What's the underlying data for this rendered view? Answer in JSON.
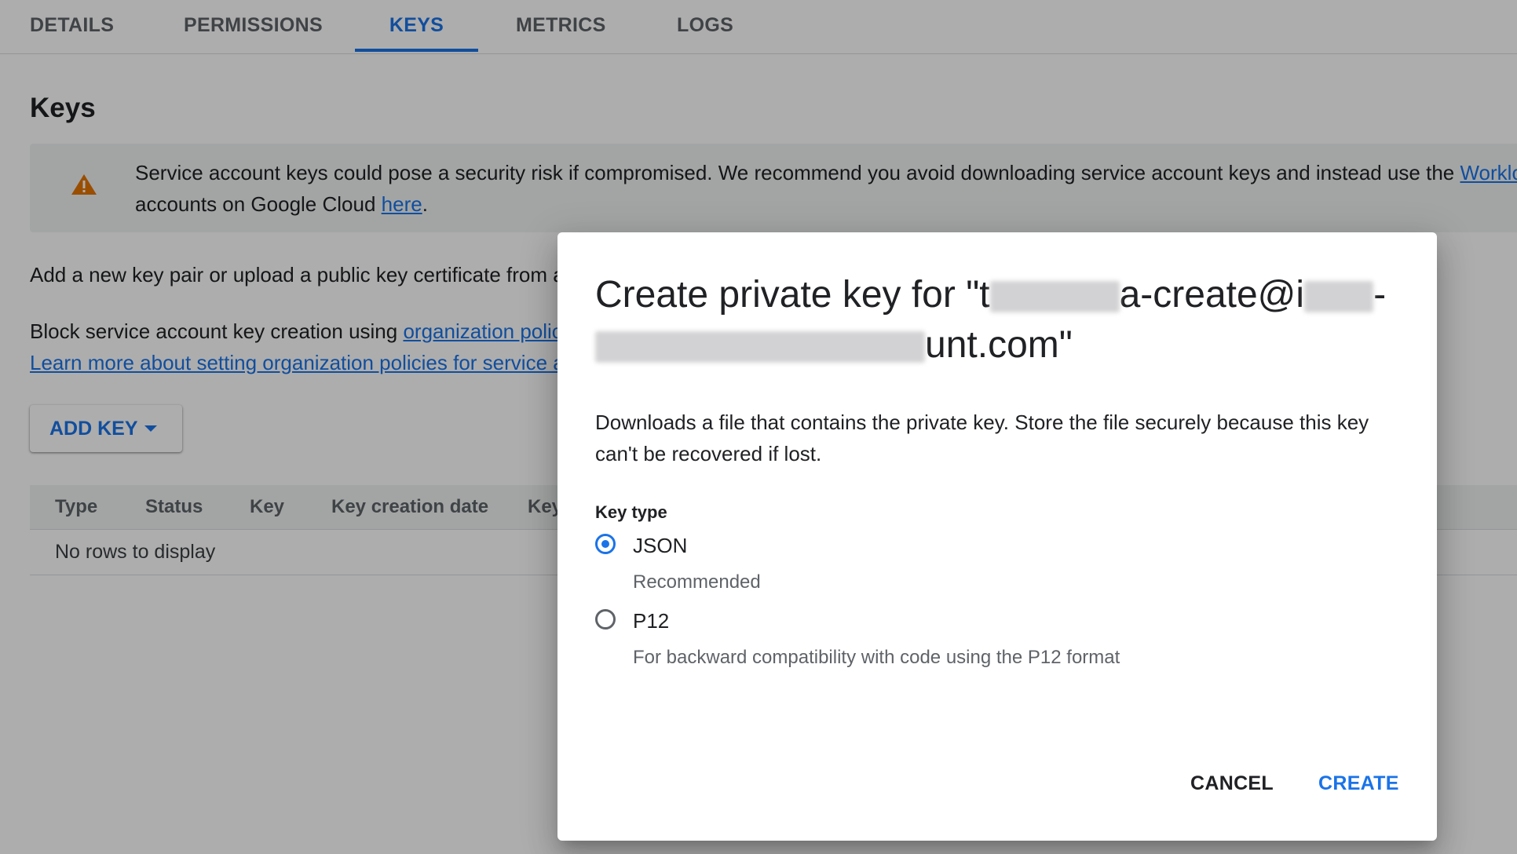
{
  "tabs": [
    {
      "label": "DETAILS",
      "active": false
    },
    {
      "label": "PERMISSIONS",
      "active": false
    },
    {
      "label": "KEYS",
      "active": true
    },
    {
      "label": "METRICS",
      "active": false
    },
    {
      "label": "LOGS",
      "active": false
    }
  ],
  "page": {
    "title": "Keys",
    "warning": {
      "icon": "warning-icon",
      "text_line1": "Service account keys could pose a security risk if compromised. We recommend you avoid downloading service account keys and instead use the ",
      "link1": "Worklo",
      "text_line2": "accounts on Google Cloud ",
      "link2": "here",
      "text_end": "."
    },
    "add_info": "Add a new key pair or upload a public key certificate from a",
    "block_text": "Block service account key creation using ",
    "block_link": "organization polic",
    "learn_more_link": "Learn more about setting organization policies for service a",
    "add_key_button": "ADD KEY",
    "table": {
      "headers": [
        "Type",
        "Status",
        "Key",
        "Key creation date",
        "Key"
      ],
      "empty_message": "No rows to display"
    }
  },
  "dialog": {
    "title_part1": "Create private key for \"t",
    "title_part2": "a-create@i",
    "title_part3": "-",
    "title_part4": "unt.com\"",
    "description": "Downloads a file that contains the private key. Store the file securely because this key can't be recovered if lost.",
    "key_type_label": "Key type",
    "options": [
      {
        "label": "JSON",
        "hint": "Recommended",
        "selected": true
      },
      {
        "label": "P12",
        "hint": "For backward compatibility with code using the P12 format",
        "selected": false
      }
    ],
    "cancel_label": "CANCEL",
    "create_label": "CREATE"
  },
  "colors": {
    "accent": "#1a73e8",
    "warning": "#e37400"
  }
}
